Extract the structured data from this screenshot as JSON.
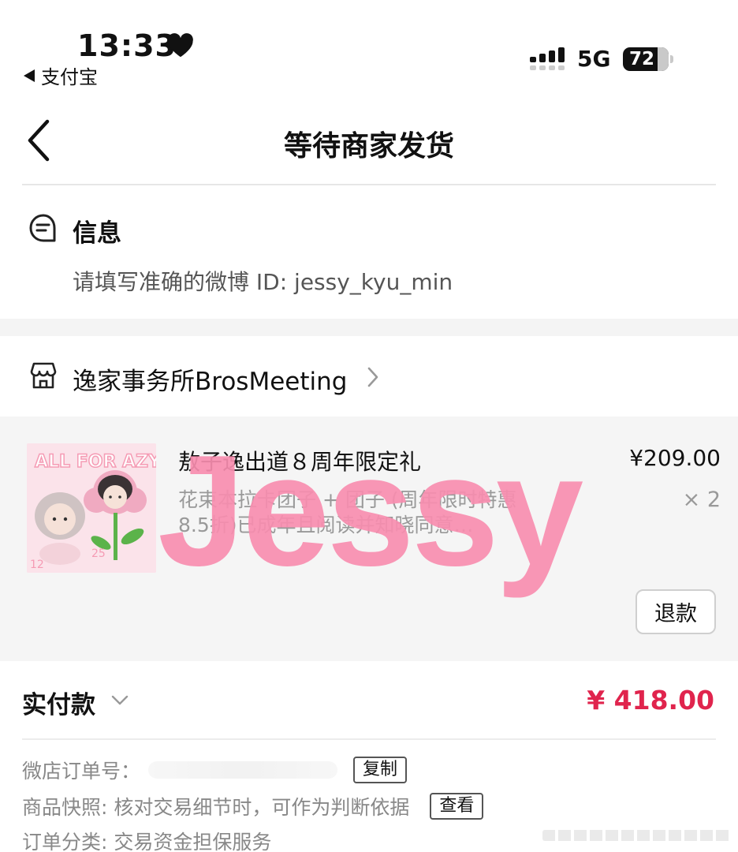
{
  "status_bar": {
    "time": "13:33",
    "back_app": "支付宝",
    "network": "5G",
    "battery": "72"
  },
  "nav": {
    "title": "等待商家发货"
  },
  "info": {
    "title": "信息",
    "text": "请填写准确的微博 ID: jessy_kyu_min"
  },
  "shop": {
    "name": "逸家事务所BrosMeeting"
  },
  "product": {
    "title": "敖子逸出道８周年限定礼",
    "description": "花束本拉卡团子 + 团子 (周年限时特惠8.5折)已成年且阅读并知晓同意…",
    "price": "¥209.00",
    "quantity": "× 2",
    "refund_label": "退款",
    "thumb_text_top": "ALL FOR AZY",
    "thumb_number_left": "12",
    "thumb_number_right": "25"
  },
  "watermark": "Jessy",
  "payment": {
    "label": "实付款",
    "amount": "¥ 418.00"
  },
  "order": {
    "number_label": "微店订单号：",
    "copy_label": "复制",
    "snapshot_label": "商品快照: 核对交易细节时，可作为判断依据",
    "view_label": "查看",
    "category_label": "订单分类:  交易资金担保服务"
  },
  "colors": {
    "accent_price": "#e0244d",
    "watermark": "#f78daf",
    "section_gap": "#f4f4f4"
  },
  "icons": {
    "heart": "heart-icon",
    "signal": "signal-icon",
    "back": "chevron-left-icon",
    "info": "message-icon",
    "shop": "store-icon",
    "shop_more": "chevron-right-icon",
    "pay_expand": "chevron-down-icon"
  }
}
